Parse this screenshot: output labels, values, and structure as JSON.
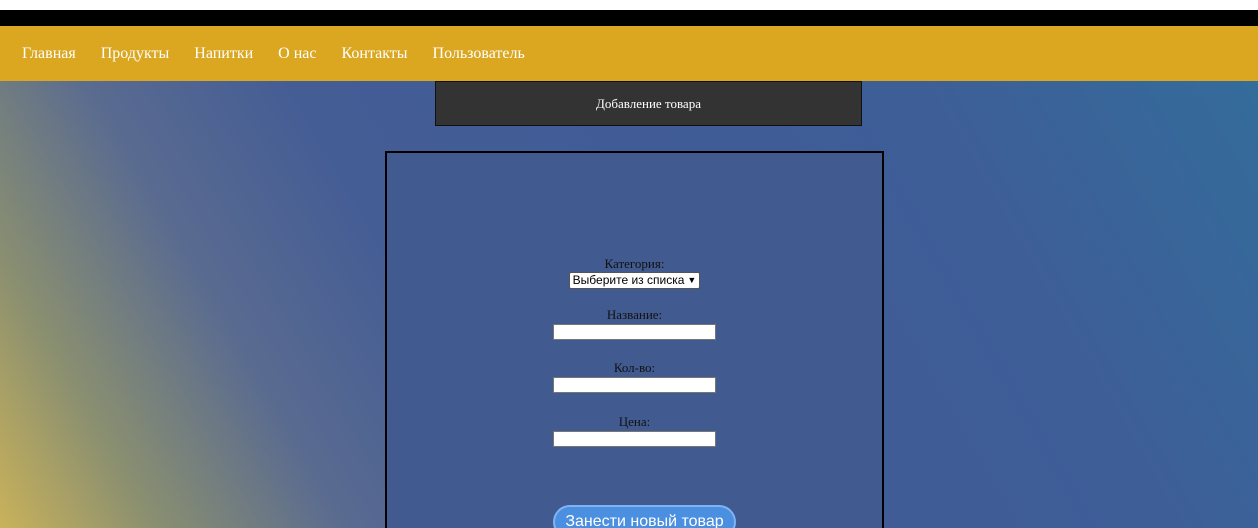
{
  "nav": {
    "items": [
      {
        "label": "Главная"
      },
      {
        "label": "Продукты"
      },
      {
        "label": "Напитки"
      },
      {
        "label": "О нас"
      },
      {
        "label": "Контакты"
      },
      {
        "label": "Пользователь"
      }
    ]
  },
  "page": {
    "title": "Добавление товара"
  },
  "form": {
    "category_label": "Категория:",
    "category_selected": "Выберите из списка",
    "name_label": "Название:",
    "name_value": "",
    "quantity_label": "Кол-во:",
    "quantity_value": "",
    "price_label": "Цена:",
    "price_value": "",
    "submit_label": "Занести новый товар"
  },
  "colors": {
    "nav_bg": "#dba720",
    "panel_bg": "#415b91",
    "title_bg": "#333333",
    "button_bg": "#4a8fe0"
  }
}
